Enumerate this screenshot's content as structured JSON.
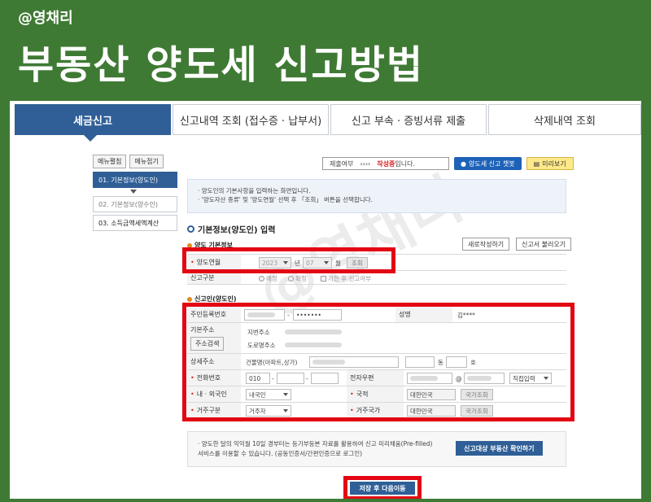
{
  "banner": {
    "handle": "@영채리",
    "title": "부동산 양도세 신고방법",
    "watermark": "@영채리"
  },
  "tabs": [
    {
      "label": "세금신고"
    },
    {
      "label": "신고내역 조회 (접수증 · 납부서)"
    },
    {
      "label": "신고 부속 · 증빙서류 제출"
    },
    {
      "label": "삭제내역 조회"
    }
  ],
  "sidenav": {
    "edit_label": "메뉴펼침",
    "collapse_label": "메뉴접기",
    "items": [
      {
        "label": "01. 기본정보(양도인)"
      },
      {
        "label": "02. 기본정보(양수인)"
      },
      {
        "label": "03. 소득금액세액계산"
      }
    ]
  },
  "topbar": {
    "status_prefix": "제출여부",
    "status_arrows": "››››",
    "status_value": "작성중",
    "status_suffix": "입니다.",
    "chatbot_label": "양도세 신고 챗봇",
    "preview_label": "미리보기"
  },
  "notice": {
    "line1": "· 양도인의 기본사항을 입력하는 화면입니다.",
    "line2": "· '양도자산 종류' 및 '양도연월' 선택 후 「조회」 버튼을 선택합니다."
  },
  "section": {
    "title": "기본정보(양도인) 입력",
    "transfer_title": "양도 기본정보",
    "new_write_label": "새로작성하기",
    "load_label": "신고서 불러오기",
    "transfer_ym_label": "양도연월",
    "year_value": "2023",
    "year_unit": "년",
    "month_value": "07",
    "month_unit": "월",
    "lookup_label": "조회",
    "report_type_label": "신고구분",
    "opt_scheduled": "예정",
    "opt_confirmed": "확정",
    "opt_late": "기한 후 신고여부"
  },
  "transferor": {
    "title": "신고인(양도인)",
    "rrn_label": "주민등록번호",
    "rrn_dash": "-",
    "rrn_masked": "•••••••",
    "name_label": "성명",
    "name_value": "김****",
    "addr_label": "기본주소",
    "addr_search_label": "주소검색",
    "lot_addr_label": "지번주소",
    "road_addr_label": "도로명주소",
    "detail_addr_label": "상세주소",
    "detail_addr_prefix": "건물명(아파트,상가)",
    "dong_unit": "동",
    "ho_unit": "호",
    "phone_label": "전화번호",
    "phone_prefix": "010",
    "phone_dash": "-",
    "email_label": "전자우편",
    "email_at": "@",
    "email_direct": "직접입력",
    "nationality_type_label": "내 · 외국인",
    "nationality_type_value": "내국인",
    "country_label": "국적",
    "country_value": "대한민국",
    "country_lookup": "국가조회",
    "residency_label": "거주구분",
    "residency_value": "거주자",
    "residence_country_label": "거주국가",
    "residence_country_value": "대한민국",
    "residence_country_lookup": "국가조회"
  },
  "bottom": {
    "notice_line1": "· 양도한 달의 익익월 10일 경부터는 등기부등본 자료를 활용하여 신고 미리채움(Pre-filled)",
    "notice_line2": "서비스를 이용할 수 있습니다. (공동인증서/간편인증으로 로그인)",
    "confirm_label": "신고대상 부동산 확인하기",
    "save_next_label": "저장 후 다음이동"
  },
  "colors": {
    "green": "#3f7a34",
    "navy": "#2f5f96",
    "highlight_red": "#e30613"
  }
}
